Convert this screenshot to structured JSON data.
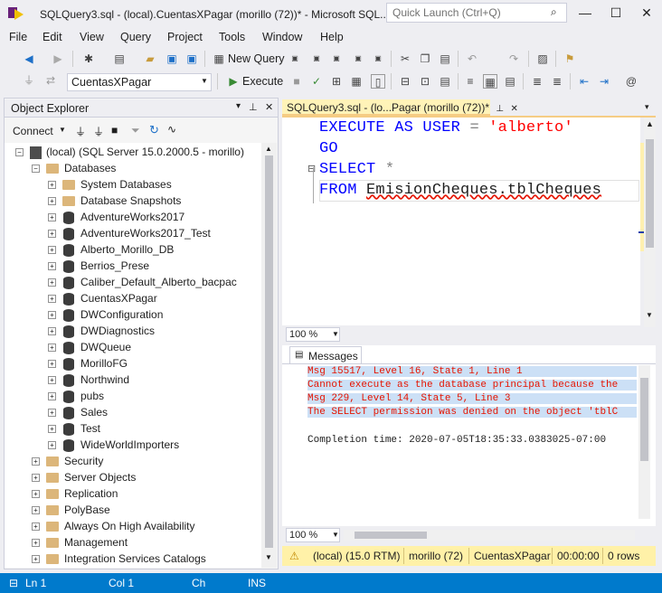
{
  "window": {
    "title": "SQLQuery3.sql - (local).CuentasXPagar (morillo (72))* - Microsoft SQL...",
    "quick_launch_placeholder": "Quick Launch (Ctrl+Q)"
  },
  "menu": [
    "File",
    "Edit",
    "View",
    "Query",
    "Project",
    "Tools",
    "Window",
    "Help"
  ],
  "toolbar": {
    "new_query": "New Query",
    "execute": "Execute",
    "database": "CuentasXPagar"
  },
  "object_explorer": {
    "title": "Object Explorer",
    "connect": "Connect",
    "server": "(local) (SQL Server 15.0.2000.5 - morillo)",
    "databases_folder": "Databases",
    "db_items": [
      "System Databases",
      "Database Snapshots",
      "AdventureWorks2017",
      "AdventureWorks2017_Test",
      "Alberto_Morillo_DB",
      "Berrios_Prese",
      "Caliber_Default_Alberto_bacpac",
      "CuentasXPagar",
      "DWConfiguration",
      "DWDiagnostics",
      "DWQueue",
      "MorilloFG",
      "Northwind",
      "pubs",
      "Sales",
      "Test",
      "WideWorldImporters"
    ],
    "top_folders": [
      "Security",
      "Server Objects",
      "Replication",
      "PolyBase",
      "Always On High Availability",
      "Management",
      "Integration Services Catalogs"
    ]
  },
  "editor": {
    "tab_label": "SQLQuery3.sql - (lo...Pagar (morillo (72))*",
    "lines": [
      {
        "k1": "EXECUTE AS USER",
        "op": "=",
        "str": "'alberto'"
      },
      {
        "k1": "GO"
      },
      {
        "k1": "SELECT",
        "op": "*"
      },
      {
        "k1": "FROM",
        "id": "EmisionCheques.tblCheques"
      }
    ],
    "zoom": "100 %"
  },
  "results": {
    "tab": "Messages",
    "lines": [
      "Msg 15517, Level 16, State 1, Line 1",
      "Cannot execute as the database principal because the",
      "Msg 229, Level 14, State 5, Line 3",
      "The SELECT permission was denied on the object 'tblC"
    ],
    "completion": "Completion time: 2020-07-05T18:35:33.0383025-07:00",
    "zoom": "100 %"
  },
  "query_status": {
    "server": "(local) (15.0 RTM)",
    "user": "morillo (72)",
    "db": "CuentasXPagar",
    "time": "00:00:00",
    "rows": "0 rows"
  },
  "statusbar": {
    "ln": "Ln 1",
    "col": "Col 1",
    "ch": "Ch",
    "ins": "INS"
  }
}
